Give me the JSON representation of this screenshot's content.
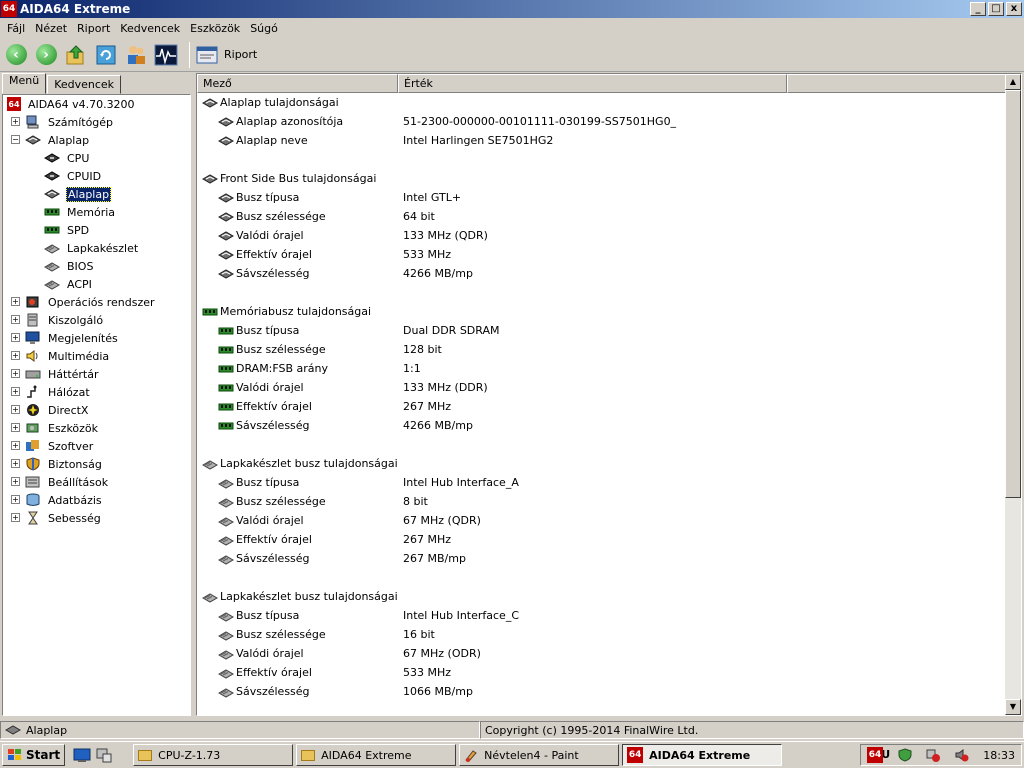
{
  "window": {
    "title": "AIDA64 Extreme",
    "icon_text": "64",
    "buttons": [
      "_",
      "□",
      "x"
    ]
  },
  "menu": [
    "Fájl",
    "Nézet",
    "Riport",
    "Kedvencek",
    "Eszközök",
    "Súgó"
  ],
  "toolbar": {
    "riport_label": "Riport"
  },
  "tabs": [
    {
      "label": "Menü",
      "active": true
    },
    {
      "label": "Kedvencek",
      "active": false
    }
  ],
  "tree": {
    "root": "AIDA64 v4.70.3200",
    "items": [
      {
        "label": "Számítógép",
        "icon": "computer-icon",
        "expand": "+",
        "level": 1
      },
      {
        "label": "Alaplap",
        "icon": "motherboard-icon",
        "expand": "-",
        "level": 1
      },
      {
        "label": "CPU",
        "icon": "cpu-icon",
        "level": 2
      },
      {
        "label": "CPUID",
        "icon": "cpu-icon",
        "level": 2
      },
      {
        "label": "Alaplap",
        "icon": "motherboard-icon",
        "level": 2,
        "selected": true
      },
      {
        "label": "Memória",
        "icon": "memory-icon",
        "level": 2
      },
      {
        "label": "SPD",
        "icon": "memory-icon",
        "level": 2
      },
      {
        "label": "Lapkakészlet",
        "icon": "chipset-icon",
        "level": 2
      },
      {
        "label": "BIOS",
        "icon": "chipset-icon",
        "level": 2
      },
      {
        "label": "ACPI",
        "icon": "chipset-icon",
        "level": 2
      },
      {
        "label": "Operációs rendszer",
        "icon": "os-icon",
        "expand": "+",
        "level": 1
      },
      {
        "label": "Kiszolgáló",
        "icon": "server-icon",
        "expand": "+",
        "level": 1
      },
      {
        "label": "Megjelenítés",
        "icon": "display-icon",
        "expand": "+",
        "level": 1
      },
      {
        "label": "Multimédia",
        "icon": "speaker-icon",
        "expand": "+",
        "level": 1
      },
      {
        "label": "Háttértár",
        "icon": "storage-icon",
        "expand": "+",
        "level": 1
      },
      {
        "label": "Hálózat",
        "icon": "network-icon",
        "expand": "+",
        "level": 1
      },
      {
        "label": "DirectX",
        "icon": "directx-icon",
        "expand": "+",
        "level": 1
      },
      {
        "label": "Eszközök",
        "icon": "devices-icon",
        "expand": "+",
        "level": 1
      },
      {
        "label": "Szoftver",
        "icon": "software-icon",
        "expand": "+",
        "level": 1
      },
      {
        "label": "Biztonság",
        "icon": "shield-icon",
        "expand": "+",
        "level": 1
      },
      {
        "label": "Beállítások",
        "icon": "settings-icon",
        "expand": "+",
        "level": 1
      },
      {
        "label": "Adatbázis",
        "icon": "database-icon",
        "expand": "+",
        "level": 1
      },
      {
        "label": "Sebesség",
        "icon": "hourglass-icon",
        "expand": "+",
        "level": 1
      }
    ]
  },
  "columns": {
    "field": "Mező",
    "value": "Érték"
  },
  "sections": [
    {
      "title": "Alaplap tulajdonságai",
      "icon": "motherboard-icon",
      "rows": [
        {
          "field": "Alaplap azonosítója",
          "value": "51-2300-000000-00101111-030199-SS7501HG0_"
        },
        {
          "field": "Alaplap neve",
          "value": "Intel Harlingen SE7501HG2"
        }
      ]
    },
    {
      "title": "Front Side Bus tulajdonságai",
      "icon": "motherboard-icon",
      "rows": [
        {
          "field": "Busz típusa",
          "value": "Intel GTL+"
        },
        {
          "field": "Busz szélessége",
          "value": "64 bit"
        },
        {
          "field": "Valódi órajel",
          "value": "133 MHz (QDR)"
        },
        {
          "field": "Effektív órajel",
          "value": "533 MHz"
        },
        {
          "field": "Sávszélesség",
          "value": "4266 MB/mp"
        }
      ]
    },
    {
      "title": "Memóriabusz tulajdonságai",
      "icon": "memory-icon",
      "rows": [
        {
          "field": "Busz típusa",
          "value": "Dual DDR SDRAM"
        },
        {
          "field": "Busz szélessége",
          "value": "128 bit"
        },
        {
          "field": "DRAM:FSB arány",
          "value": "1:1"
        },
        {
          "field": "Valódi órajel",
          "value": "133 MHz (DDR)"
        },
        {
          "field": "Effektív órajel",
          "value": "267 MHz"
        },
        {
          "field": "Sávszélesség",
          "value": "4266 MB/mp"
        }
      ]
    },
    {
      "title": "Lapkakészlet busz tulajdonságai",
      "icon": "chipset-icon",
      "rows": [
        {
          "field": "Busz típusa",
          "value": "Intel Hub Interface_A"
        },
        {
          "field": "Busz szélessége",
          "value": "8 bit"
        },
        {
          "field": "Valódi órajel",
          "value": "67 MHz (QDR)"
        },
        {
          "field": "Effektív órajel",
          "value": "267 MHz"
        },
        {
          "field": "Sávszélesség",
          "value": "267 MB/mp"
        }
      ]
    },
    {
      "title": "Lapkakészlet busz tulajdonságai",
      "icon": "chipset-icon",
      "rows": [
        {
          "field": "Busz típusa",
          "value": "Intel Hub Interface_C"
        },
        {
          "field": "Busz szélessége",
          "value": "16 bit"
        },
        {
          "field": "Valódi órajel",
          "value": "67 MHz (ODR)"
        },
        {
          "field": "Effektív órajel",
          "value": "533 MHz"
        },
        {
          "field": "Sávszélesség",
          "value": "1066 MB/mp"
        }
      ]
    }
  ],
  "status": {
    "left": "Alaplap",
    "right": "Copyright (c) 1995-2014 FinalWire Ltd."
  },
  "taskbar": {
    "start": "Start",
    "tasks": [
      {
        "label": "CPU-Z-1.73",
        "icon": "folder-icon",
        "active": false
      },
      {
        "label": "AIDA64 Extreme",
        "icon": "folder-icon",
        "active": false
      },
      {
        "label": "Névtelen4 - Paint",
        "icon": "paint-icon",
        "active": false
      },
      {
        "label": "AIDA64 Extreme",
        "icon": "aida-icon",
        "active": true
      }
    ],
    "lang": "HU",
    "clock": "18:33",
    "tray_icon_text": "64"
  },
  "colors": {
    "title_start": "#0a246a",
    "title_end": "#a6caf0",
    "selection": "#0a246a",
    "face": "#d4d0c8"
  }
}
